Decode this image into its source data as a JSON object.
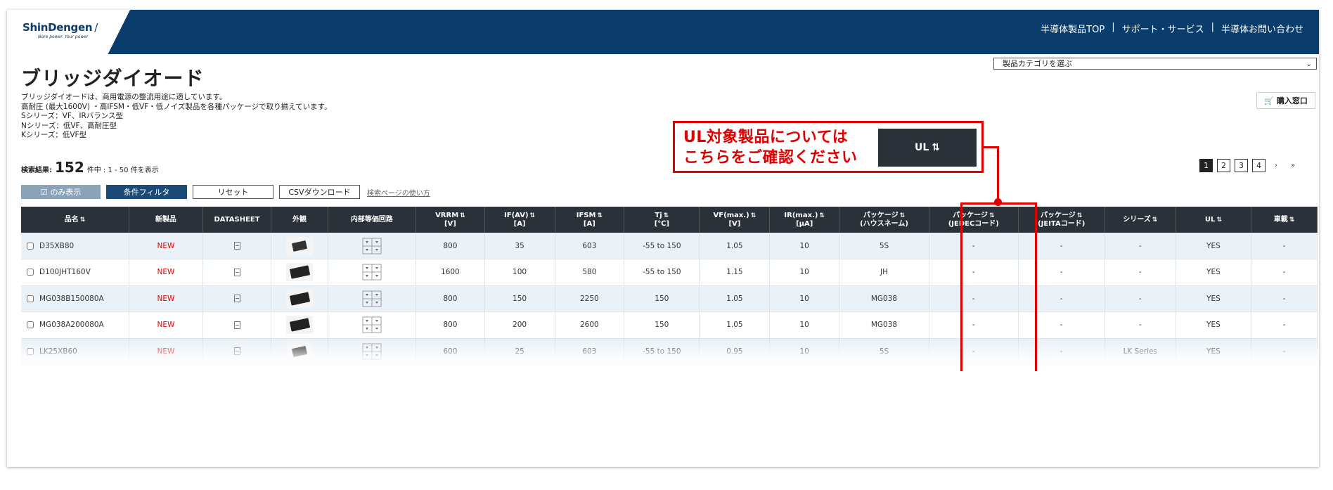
{
  "header": {
    "logo": "ShinDengen",
    "logo_tagline": "Nore power. Your power",
    "nav": [
      "半導体製品TOP",
      "サポート・サービス",
      "半導体お問い合わせ"
    ]
  },
  "category_select": {
    "value": "製品カテゴリを選ぶ"
  },
  "title": "ブリッジダイオード",
  "description": [
    "ブリッジダイオードは、商用電源の整流用途に適しています。",
    "高耐圧 (最大1600V) ・高IFSM・低VF・低ノイズ製品を各種パッケージで取り揃えています。",
    "Sシリーズ：VF、IRバランス型",
    "Nシリーズ：低VF、高耐圧型",
    "Kシリーズ：低VF型"
  ],
  "buy_button": "購入窓口",
  "result": {
    "label": "検索結果:",
    "count": "152",
    "suffix": "件中 : 1 - 50 件を表示"
  },
  "buttons": {
    "only_checked": "のみ表示",
    "filter": "条件フィルタ",
    "reset": "リセット",
    "csv": "CSVダウンロード",
    "help": "検索ページの使い方"
  },
  "pagination": {
    "pages": [
      "1",
      "2",
      "3",
      "4"
    ],
    "next": "›",
    "last": "»"
  },
  "table": {
    "headers": {
      "name": "品名",
      "new": "新製品",
      "datasheet": "DATASHEET",
      "appearance": "外観",
      "circuit": "内部等価回路",
      "vrrm_main": "VRRM",
      "vrrm_unit": "[V]",
      "if_main": "IF(AV)",
      "if_unit": "[A]",
      "ifsm_main": "IFSM",
      "ifsm_unit": "[A]",
      "tj_main": "Tj",
      "tj_unit": "[℃]",
      "vf_main": "VF(max.)",
      "vf_unit": "[V]",
      "ir_main": "IR(max.)",
      "ir_unit": "[μA]",
      "pkg_house_main": "パッケージ",
      "pkg_house_sub": "(ハウスネーム)",
      "pkg_jedec_main": "パッケージ",
      "pkg_jedec_sub": "(JEDECコード)",
      "pkg_jeita_main": "パッケージ",
      "pkg_jeita_sub": "(JEITAコード)",
      "series": "シリーズ",
      "ul": "UL",
      "auto": "車載"
    },
    "rows": [
      {
        "name": "D35XB80",
        "new": "NEW",
        "vrrm": "800",
        "if": "35",
        "ifsm": "603",
        "tj": "-55 to 150",
        "vf": "1.05",
        "ir": "10",
        "pkg": "5S",
        "jedec": "-",
        "jeita": "-",
        "series": "-",
        "ul": "YES",
        "auto": "-"
      },
      {
        "name": "D100JHT160V",
        "new": "NEW",
        "vrrm": "1600",
        "if": "100",
        "ifsm": "580",
        "tj": "-55 to 150",
        "vf": "1.15",
        "ir": "10",
        "pkg": "JH",
        "jedec": "-",
        "jeita": "-",
        "series": "-",
        "ul": "YES",
        "auto": "-"
      },
      {
        "name": "MG038B150080A",
        "new": "NEW",
        "vrrm": "800",
        "if": "150",
        "ifsm": "2250",
        "tj": "150",
        "vf": "1.05",
        "ir": "10",
        "pkg": "MG038",
        "jedec": "-",
        "jeita": "-",
        "series": "-",
        "ul": "YES",
        "auto": "-"
      },
      {
        "name": "MG038A200080A",
        "new": "NEW",
        "vrrm": "800",
        "if": "200",
        "ifsm": "2600",
        "tj": "150",
        "vf": "1.05",
        "ir": "10",
        "pkg": "MG038",
        "jedec": "-",
        "jeita": "-",
        "series": "-",
        "ul": "YES",
        "auto": "-"
      },
      {
        "name": "LK25XB60",
        "new": "NEW",
        "vrrm": "600",
        "if": "25",
        "ifsm": "603",
        "tj": "-55 to 150",
        "vf": "0.95",
        "ir": "10",
        "pkg": "5S",
        "jedec": "-",
        "jeita": "-",
        "series": "LK Series",
        "ul": "YES",
        "auto": "-"
      }
    ]
  },
  "annotation": {
    "line1": "UL対象製品については",
    "line2": "こちらをご確認ください",
    "button": "UL"
  },
  "colors": {
    "header_bg": "#0a3d6b",
    "table_header_bg": "#2b3139",
    "annotation": "#e00000",
    "new_badge": "#e00000"
  }
}
